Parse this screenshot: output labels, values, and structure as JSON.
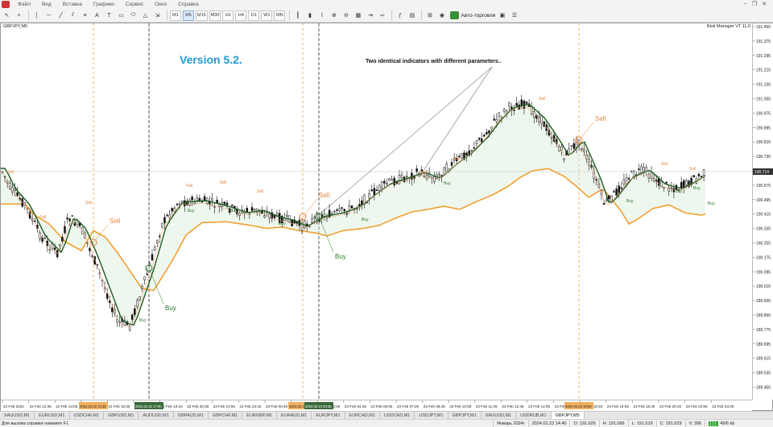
{
  "menu": [
    "Файл",
    "Вид",
    "Вставка",
    "Графики",
    "Сервис",
    "Окно",
    "Справка"
  ],
  "toolbar": {
    "timeframes": [
      "M1",
      "M5",
      "M15",
      "M30",
      "H1",
      "H4",
      "D1",
      "W1",
      "MN"
    ],
    "active_timeframe": "M5",
    "autotrade_label": "Авто-торговля"
  },
  "chart": {
    "symbol_label": "GBPJPY,M5",
    "risk_label": "Risk Manager VT 11.0",
    "version_text": "Version 5.2.",
    "annotation_text": "Two identical indicators with different parameters..",
    "current_price": "190.714",
    "price_ticks": [
      "191.455",
      "191.375",
      "191.295",
      "191.215",
      "191.135",
      "191.055",
      "190.975",
      "190.895",
      "190.815",
      "190.735",
      "190.655",
      "190.575",
      "190.495",
      "190.415",
      "190.335",
      "190.255",
      "190.175",
      "190.095",
      "190.015",
      "189.935",
      "189.855",
      "189.775",
      "189.695",
      "189.615",
      "189.535",
      "189.455"
    ],
    "time_ticks": [
      "22 Feb 2024",
      "22 Feb 12:35",
      "22 Feb 13:55",
      "22 Feb 15:15",
      "22 Feb 16:35",
      "22 Feb 17:55",
      "22 Feb 19:15",
      "22 Feb 20:35",
      "22 Feb 21:55",
      "22 Feb 23:15",
      "23 Feb 00:45",
      "23 Feb 02:05",
      "23 Feb 03:25",
      "23 Feb 04:45",
      "23 Feb 06:05",
      "23 Feb 07:25",
      "23 Feb 08:45",
      "23 Feb 10:05",
      "23 Feb 11:25",
      "23 Feb 12:45",
      "23 Feb 14:05",
      "23 Feb 15:25",
      "23 Feb 16:45",
      "23 Feb 18:05",
      "23 Feb 19:25",
      "23 Feb 20:45",
      "23 Feb 22:05",
      "23 Feb 23:25"
    ],
    "highlighted_times": [
      "2024.02.22 14:35",
      "2024.02.22 17:00",
      "2024.02.23 01:10",
      "2024.02.23 03:35",
      "2024.02.23 16:50"
    ],
    "signals": [
      {
        "label": "Sell",
        "type": "sell"
      },
      {
        "label": "Sell",
        "type": "sell"
      },
      {
        "label": "Sell",
        "type": "sell"
      },
      {
        "label": "Sell",
        "type": "sell"
      },
      {
        "label": "Sell",
        "type": "sell"
      },
      {
        "label": "Sell",
        "type": "sell"
      },
      {
        "label": "Sell",
        "type": "sell"
      },
      {
        "label": "Sell",
        "type": "sell"
      },
      {
        "label": "Sell",
        "type": "sell"
      },
      {
        "label": "Sell",
        "type": "sell"
      },
      {
        "label": "Sell",
        "type": "sell"
      },
      {
        "label": "Sell",
        "type": "sell"
      },
      {
        "label": "Sell",
        "type": "sell"
      },
      {
        "label": "Sell",
        "type": "sell"
      },
      {
        "label": "Buy",
        "type": "buy"
      },
      {
        "label": "Buy",
        "type": "buy"
      },
      {
        "label": "Buy",
        "type": "buy"
      },
      {
        "label": "Buy",
        "type": "buy"
      },
      {
        "label": "Buy",
        "type": "buy"
      },
      {
        "label": "Buy",
        "type": "buy"
      },
      {
        "label": "Buy",
        "type": "buy"
      },
      {
        "label": "Buy",
        "type": "buy"
      },
      {
        "label": "Buy",
        "type": "buy"
      },
      {
        "label": "Buy",
        "type": "buy"
      },
      {
        "label": "Buy",
        "type": "buy"
      },
      {
        "label": "Buy",
        "type": "buy"
      }
    ],
    "colors": {
      "sell": "#e8833a",
      "buy": "#2a7a2a",
      "slow_ma": "#f0a030",
      "fast_ma": "#1f5a1f",
      "vline_orange": "#f2b060",
      "vline_dark": "#555555"
    }
  },
  "tabs": [
    "XAUUSD,M1",
    "EURUSD,M1",
    "USDCHF,M1",
    "GBPUSD,M1",
    "AUDUSD,M1",
    "GBPAUD,M1",
    "GBPCHF,M1",
    "EURGBP,M1",
    "EURAUD,M1",
    "EURJPY,M1",
    "EURCAD,M1",
    "USDCAD,M1",
    "USDJPY,M1",
    "GBPJPY,M1",
    "XAGUSD,M1",
    "USDRUB,M1",
    "GBPJPY,M5"
  ],
  "active_tab": "GBPJPY,M5",
  "status": {
    "help": "Для вызова справки нажмите F1",
    "profile": "Январь 2024г",
    "datetime": "2024.02.23 14:40",
    "open": "O: 191.026",
    "high": "H: 191.066",
    "low": "L: 191.019",
    "close": "C: 191.029",
    "volume": "V: 396",
    "traffic": "49/6 kb"
  }
}
